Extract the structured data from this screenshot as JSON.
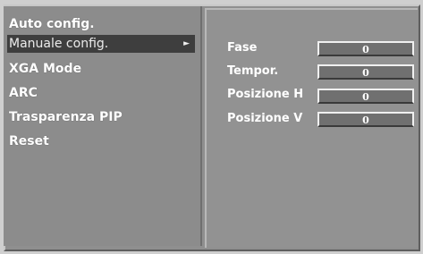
{
  "left_menu": {
    "items": [
      {
        "label": "Auto config."
      },
      {
        "label": "Manuale config.",
        "selected": true,
        "arrow": "►"
      },
      {
        "label": "XGA Mode"
      },
      {
        "label": "ARC"
      },
      {
        "label": "Trasparenza PIP"
      },
      {
        "label": "Reset"
      }
    ]
  },
  "right_panel": {
    "params": [
      {
        "label": "Fase",
        "value": "0"
      },
      {
        "label": "Tempor.",
        "value": "0"
      },
      {
        "label": "Posizione H",
        "value": "0"
      },
      {
        "label": "Posizione V",
        "value": "0"
      }
    ]
  },
  "colors": {
    "panel_bg": "#8c8c8c",
    "selection_bg": "#3e3e3e",
    "text": "#ffffff"
  }
}
